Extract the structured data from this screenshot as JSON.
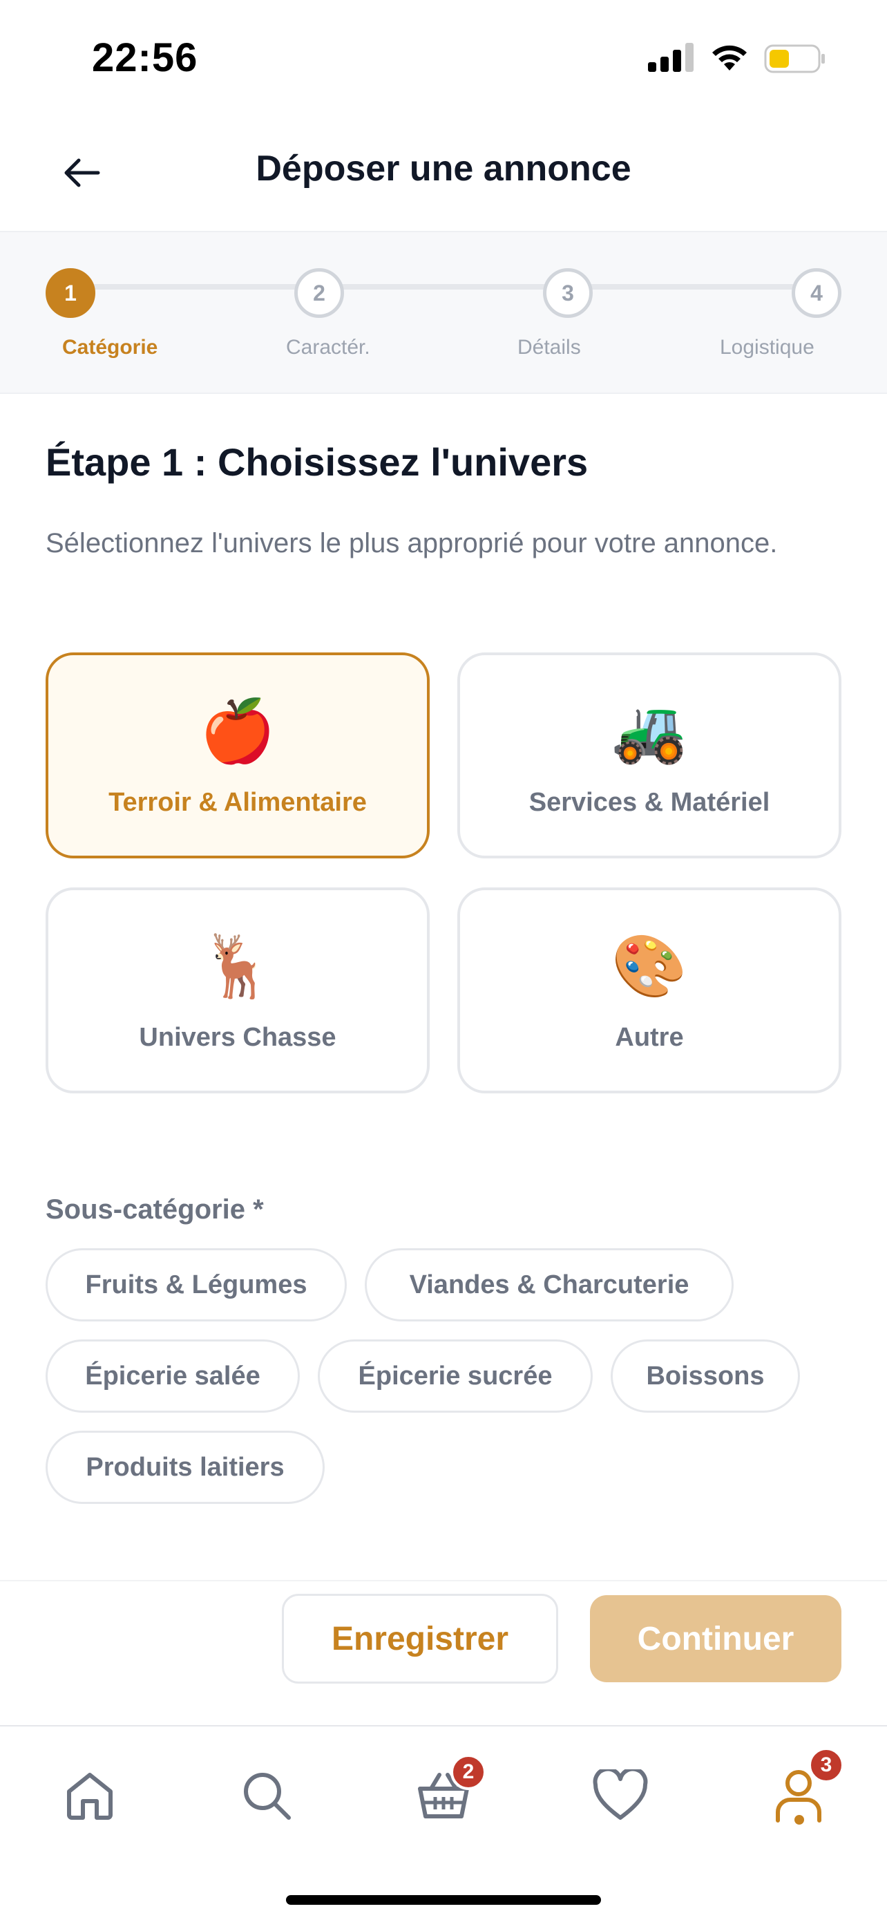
{
  "status_bar": {
    "time": "22:56"
  },
  "header": {
    "title": "Déposer une annonce"
  },
  "stepper": {
    "steps": [
      {
        "number": "1",
        "label": "Catégorie",
        "active": true
      },
      {
        "number": "2",
        "label": "Caractér.",
        "active": false
      },
      {
        "number": "3",
        "label": "Détails",
        "active": false
      },
      {
        "number": "4",
        "label": "Logistique",
        "active": false
      }
    ]
  },
  "main": {
    "title": "Étape 1 : Choisissez l'univers",
    "description": "Sélectionnez l'univers le plus approprié pour votre annonce.",
    "categories": [
      {
        "icon": "🍎",
        "icon_name": "apple-icon",
        "label": "Terroir & Alimentaire",
        "selected": true
      },
      {
        "icon": "🚜",
        "icon_name": "tractor-icon",
        "label": "Services & Matériel",
        "selected": false
      },
      {
        "icon": "🦌",
        "icon_name": "deer-icon",
        "label": "Univers Chasse",
        "selected": false
      },
      {
        "icon": "🎨",
        "icon_name": "palette-icon",
        "label": "Autre",
        "selected": false
      }
    ],
    "subcategory_title": "Sous-catégorie *",
    "subcategories": [
      "Fruits & Légumes",
      "Viandes & Charcuterie",
      "Épicerie salée",
      "Épicerie sucrée",
      "Boissons",
      "Produits laitiers"
    ]
  },
  "actions": {
    "save_label": "Enregistrer",
    "continue_label": "Continuer"
  },
  "bottom_nav": {
    "cart_badge": "2",
    "profile_badge": "3"
  },
  "colors": {
    "accent": "#c7821f",
    "accent_light": "#e6c391",
    "badge": "#c0392b"
  }
}
